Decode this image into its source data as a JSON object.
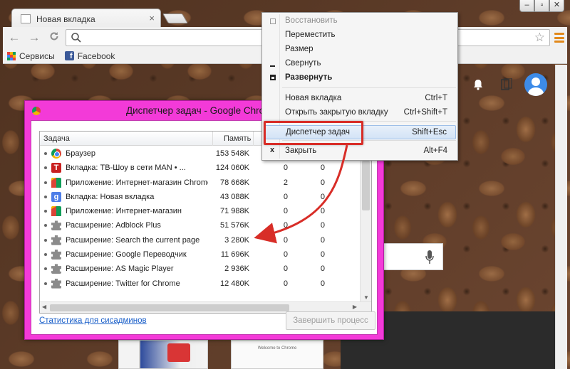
{
  "browser": {
    "tab": {
      "title": "Новая вкладка",
      "close": "×"
    },
    "window_controls": [
      "‒",
      "▫",
      "✕"
    ],
    "nav": {
      "back": "←",
      "forward": "→",
      "reload": "C"
    },
    "omnibox": {
      "value": "",
      "placeholder": ""
    },
    "bookmarks": [
      {
        "label": "Сервисы",
        "icon": "apps-icon"
      },
      {
        "label": "Facebook",
        "icon": "facebook-icon"
      }
    ]
  },
  "newtab": {
    "welcome_thumb_text": "Welcome to Chrome"
  },
  "task_manager": {
    "title": "Диспетчер задач - Google Chrome",
    "columns": {
      "task": "Задача",
      "memory": "Память"
    },
    "rows": [
      {
        "icon": "chrome",
        "name": "Браузер",
        "memory": "153 548K",
        "cpu": "",
        "net": ""
      },
      {
        "icon": "t",
        "name": "Вкладка: ТВ-Шоу в сети MAN • ...",
        "memory": "124 060K",
        "cpu": "0",
        "net": "0"
      },
      {
        "icon": "store",
        "name": "Приложение: Интернет-магазин Chrome",
        "memory": "78 668K",
        "cpu": "2",
        "net": "0"
      },
      {
        "icon": "g",
        "name": "Вкладка: Новая вкладка",
        "memory": "43 088K",
        "cpu": "0",
        "net": "0"
      },
      {
        "icon": "store",
        "name": "Приложение: Интернет-магазин",
        "memory": "71 988K",
        "cpu": "0",
        "net": "0"
      },
      {
        "icon": "puzzle",
        "name": "Расширение: Adblock Plus",
        "memory": "51 576K",
        "cpu": "0",
        "net": "0"
      },
      {
        "icon": "puzzle",
        "name": "Расширение: Search the current page",
        "memory": "3 280K",
        "cpu": "0",
        "net": "0"
      },
      {
        "icon": "puzzle",
        "name": "Расширение: Google Переводчик",
        "memory": "11 696K",
        "cpu": "0",
        "net": "0"
      },
      {
        "icon": "puzzle",
        "name": "Расширение: AS Magic Player",
        "memory": "2 936K",
        "cpu": "0",
        "net": "0"
      },
      {
        "icon": "puzzle",
        "name": "Расширение: Twitter for Chrome",
        "memory": "12 480K",
        "cpu": "0",
        "net": "0"
      }
    ],
    "stats_link": "Статистика для сисадминов",
    "end_process": "Завершить процесс"
  },
  "context_menu": {
    "items": [
      {
        "label": "Восстановить",
        "shortcut": "",
        "state": "disabled",
        "glyph": "restore-icon"
      },
      {
        "label": "Переместить",
        "shortcut": "",
        "state": "normal",
        "glyph": ""
      },
      {
        "label": "Размер",
        "shortcut": "",
        "state": "normal",
        "glyph": ""
      },
      {
        "label": "Свернуть",
        "shortcut": "",
        "state": "normal",
        "glyph": "minimize-icon"
      },
      {
        "label": "Развернуть",
        "shortcut": "",
        "state": "bold",
        "glyph": "maximize-icon"
      },
      {
        "label": "Новая вкладка",
        "shortcut": "Ctrl+T",
        "state": "normal",
        "glyph": ""
      },
      {
        "label": "Открыть закрытую вкладку",
        "shortcut": "Ctrl+Shift+T",
        "state": "normal",
        "glyph": ""
      },
      {
        "label": "Диспетчер задач",
        "shortcut": "Shift+Esc",
        "state": "highlighted",
        "glyph": ""
      },
      {
        "label": "Закрыть",
        "shortcut": "Alt+F4",
        "state": "normal",
        "glyph": "x"
      }
    ]
  },
  "colors": {
    "task_manager_frame": "#f33ad8",
    "annotation_red": "#d82d27",
    "menu_highlight": "#d3e3f6",
    "link_blue": "#1a5fc9"
  }
}
